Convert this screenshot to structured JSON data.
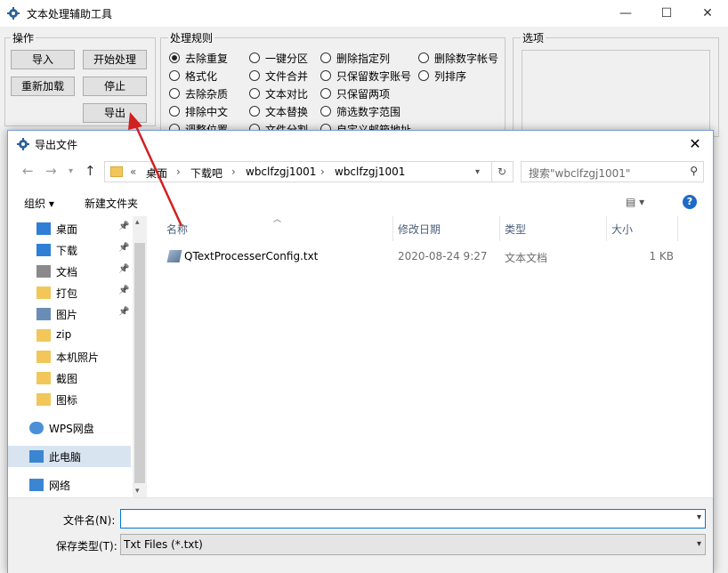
{
  "app": {
    "title": "文本处理辅助工具",
    "minimize": "—",
    "maximize": "☐",
    "close": "✕"
  },
  "operations": {
    "title": "操作",
    "import": "导入",
    "start": "开始处理",
    "reload": "重新加载",
    "stop": "停止",
    "export": "导出"
  },
  "rules": {
    "title": "处理规则",
    "items": [
      {
        "label": "去除重复",
        "checked": true
      },
      {
        "label": "格式化",
        "checked": false
      },
      {
        "label": "去除杂质",
        "checked": false
      },
      {
        "label": "排除中文",
        "checked": false
      },
      {
        "label": "调整位置",
        "checked": false
      },
      {
        "label": "一键分区",
        "checked": false
      },
      {
        "label": "文件合并",
        "checked": false
      },
      {
        "label": "文本对比",
        "checked": false
      },
      {
        "label": "文本替换",
        "checked": false
      },
      {
        "label": "文件分割",
        "checked": false
      },
      {
        "label": "删除指定列",
        "checked": false
      },
      {
        "label": "只保留数字账号",
        "checked": false
      },
      {
        "label": "只保留两项",
        "checked": false
      },
      {
        "label": "筛选数字范围",
        "checked": false
      },
      {
        "label": "自定义邮箱地址",
        "checked": false
      },
      {
        "label": "删除数字帐号",
        "checked": false
      },
      {
        "label": "列排序",
        "checked": false
      }
    ]
  },
  "options": {
    "title": "选项"
  },
  "dialog": {
    "title": "导出文件",
    "close": "✕",
    "breadcrumb": [
      "桌面",
      "下载吧",
      "wbclfzgj1001",
      "wbclfzgj1001"
    ],
    "breadcrumb_overflow": "«",
    "search_placeholder": "搜索\"wbclfzgj1001\"",
    "toolbar": {
      "organize": "组织 ▾",
      "new_folder": "新建文件夹",
      "help": "?"
    },
    "nav": [
      {
        "label": "桌面",
        "icon": "desktop-icon",
        "pinned": true
      },
      {
        "label": "下载",
        "icon": "download-icon",
        "pinned": true
      },
      {
        "label": "文档",
        "icon": "document-icon",
        "pinned": true
      },
      {
        "label": "打包",
        "icon": "folder-icon",
        "pinned": true
      },
      {
        "label": "图片",
        "icon": "picture-icon",
        "pinned": true
      },
      {
        "label": "zip",
        "icon": "folder-icon",
        "pinned": false
      },
      {
        "label": "本机照片",
        "icon": "folder-icon",
        "pinned": false
      },
      {
        "label": "截图",
        "icon": "folder-icon",
        "pinned": false
      },
      {
        "label": "图标",
        "icon": "folder-icon",
        "pinned": false
      },
      {
        "label": "WPS网盘",
        "icon": "cloud-icon",
        "pinned": false
      },
      {
        "label": "此电脑",
        "icon": "computer-icon",
        "pinned": false,
        "selected": true
      },
      {
        "label": "网络",
        "icon": "network-icon",
        "pinned": false
      }
    ],
    "columns": {
      "name": "名称",
      "date": "修改日期",
      "type": "类型",
      "size": "大小"
    },
    "files": [
      {
        "name": "QTextProcesserConfig.txt",
        "date": "2020-08-24 9:27",
        "type": "文本文档",
        "size": "1 KB"
      }
    ],
    "filename_label": "文件名(N):",
    "filename_value": "",
    "filetype_label": "保存类型(T):",
    "filetype_value": "Txt Files (*.txt)"
  }
}
